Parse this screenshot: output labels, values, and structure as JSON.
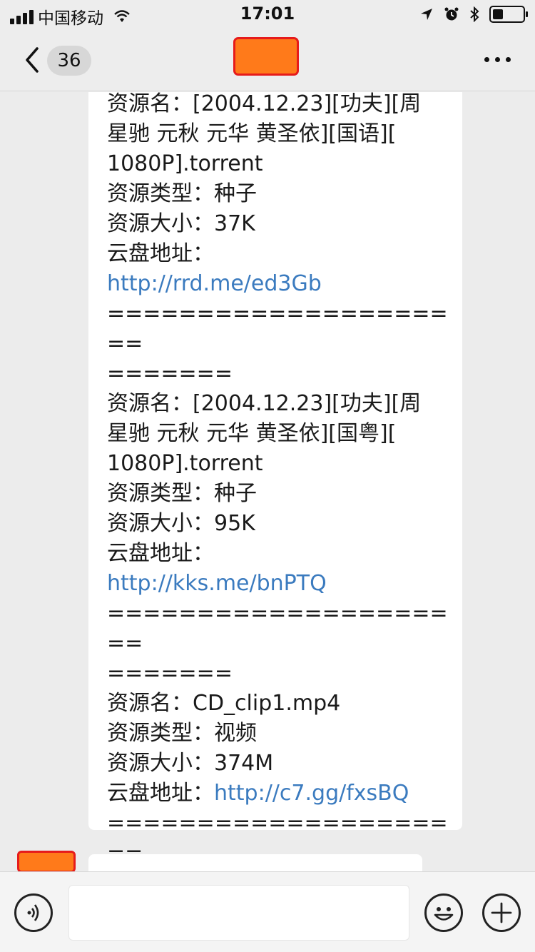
{
  "status_bar": {
    "carrier": "中国移动",
    "time": "17:01",
    "battery_level": 0.35,
    "icons": [
      "signal-icon",
      "wifi-icon",
      "location-icon",
      "alarm-icon",
      "bluetooth-icon",
      "battery-icon"
    ]
  },
  "nav": {
    "unread_count": "36",
    "icons": [
      "back-chevron-icon",
      "more-icon"
    ]
  },
  "message": {
    "lines": [
      {
        "text": "资源名：[2004.12.23][功夫][周",
        "link": false
      },
      {
        "text": "星驰 元秋 元华 黄圣依][国语][",
        "link": false
      },
      {
        "text": "1080P].torrent",
        "link": false
      },
      {
        "text": "资源类型：种子",
        "link": false
      },
      {
        "text": "资源大小：37K",
        "link": false
      },
      {
        "text": "云盘地址：",
        "link": false
      },
      {
        "text": "http://rrd.me/ed3Gb",
        "link": true
      },
      {
        "text": "=====================",
        "link": false
      },
      {
        "text": "=======",
        "link": false
      },
      {
        "text": "资源名：[2004.12.23][功夫][周",
        "link": false
      },
      {
        "text": "星驰 元秋 元华 黄圣依][国粤][",
        "link": false
      },
      {
        "text": "1080P].torrent",
        "link": false
      },
      {
        "text": "资源类型：种子",
        "link": false
      },
      {
        "text": "资源大小：95K",
        "link": false
      },
      {
        "text": "云盘地址：",
        "link": false
      },
      {
        "text": "http://kks.me/bnPTQ",
        "link": true
      },
      {
        "text": "=====================",
        "link": false
      },
      {
        "text": "=======",
        "link": false
      },
      {
        "text": "资源名：CD_clip1.mp4",
        "link": false
      },
      {
        "text": "资源类型：视频",
        "link": false
      },
      {
        "text": "资源大小：374M",
        "link": false
      },
      {
        "text": "云盘地址：",
        "link": false,
        "inline_link": "http://c7.gg/fxsBQ"
      },
      {
        "text": "=====================",
        "link": false
      },
      {
        "text": "=======",
        "link": false
      }
    ]
  },
  "input_bar": {
    "icons": [
      "voice-icon",
      "emoji-icon",
      "plus-icon"
    ],
    "input_value": ""
  },
  "colors": {
    "link": "#3b7bbf",
    "redaction_fill": "#ff7a1a",
    "redaction_border": "#e61b1b",
    "background": "#ececec",
    "bubble": "#ffffff"
  }
}
